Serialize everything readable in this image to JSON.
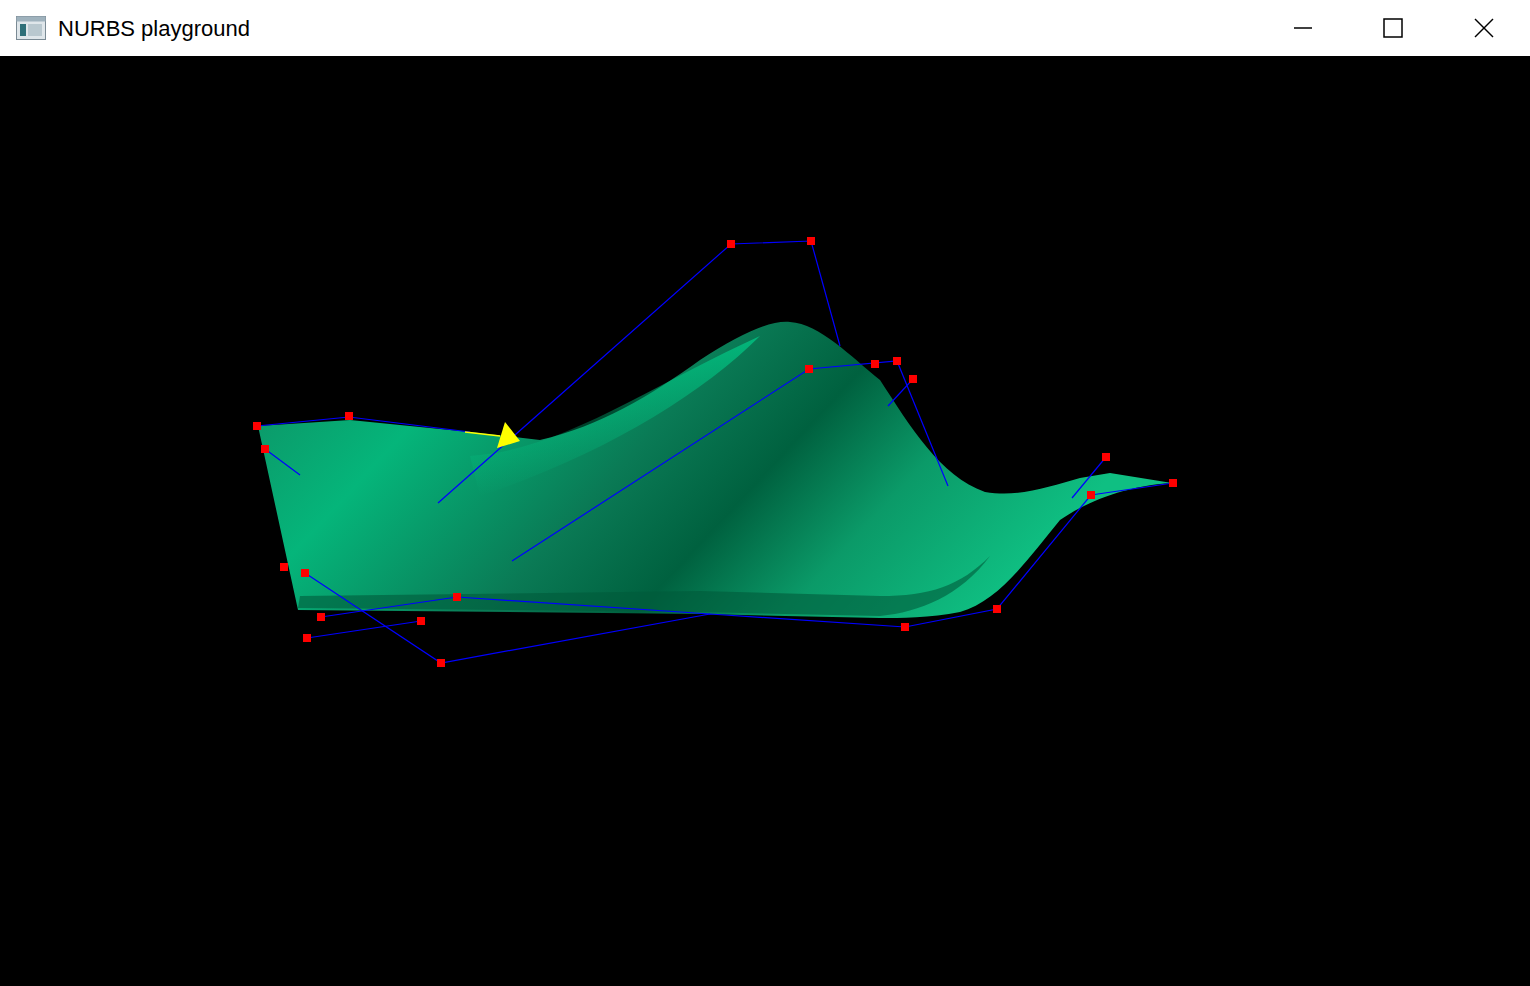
{
  "window": {
    "title": "NURBS playground"
  }
}
